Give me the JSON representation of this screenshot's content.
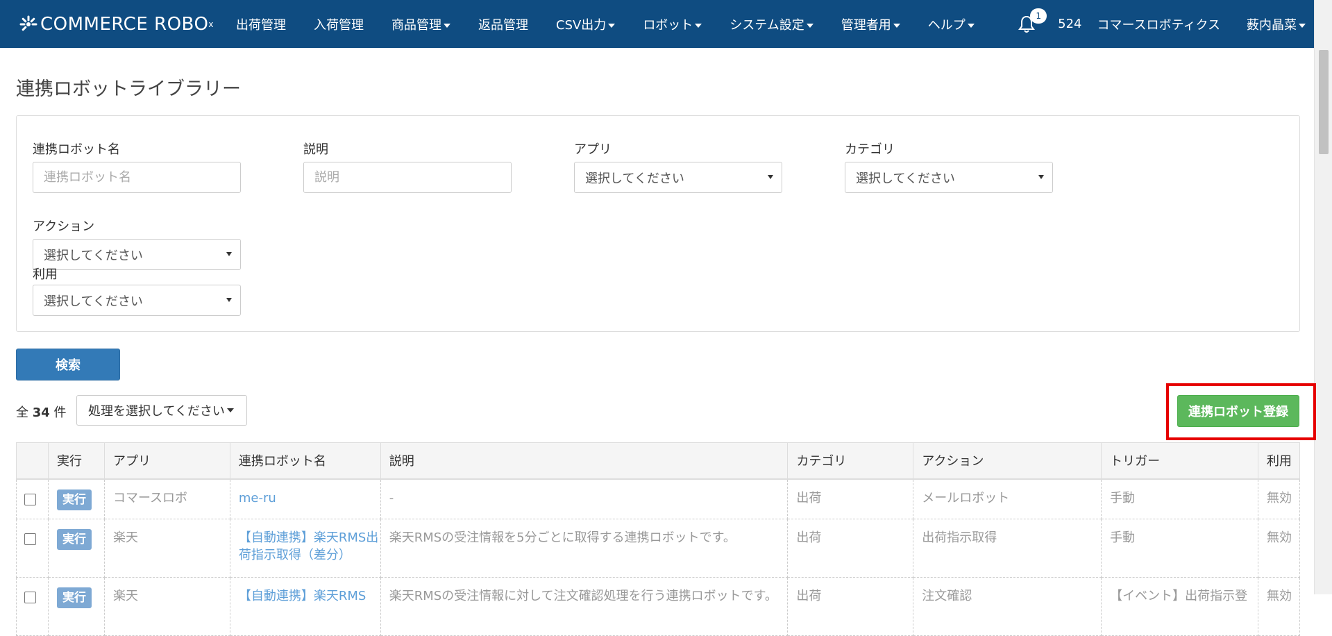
{
  "navbar": {
    "brand": "COMMERCE ROBO",
    "brand_sup": "x",
    "items": [
      {
        "label": "出荷管理",
        "dropdown": false
      },
      {
        "label": "入荷管理",
        "dropdown": false
      },
      {
        "label": "商品管理",
        "dropdown": true
      },
      {
        "label": "返品管理",
        "dropdown": false
      },
      {
        "label": "CSV出力",
        "dropdown": true
      },
      {
        "label": "ロボット",
        "dropdown": true
      },
      {
        "label": "システム設定",
        "dropdown": true
      },
      {
        "label": "管理者用",
        "dropdown": true
      },
      {
        "label": "ヘルプ",
        "dropdown": true
      }
    ],
    "notification_count": "1",
    "shop_id": "524",
    "company": "コマースロボティクス",
    "user": "薮内晶菜"
  },
  "page": {
    "title": "連携ロボットライブラリー"
  },
  "filters": {
    "robot_name_label": "連携ロボット名",
    "robot_name_placeholder": "連携ロボット名",
    "description_label": "説明",
    "description_placeholder": "説明",
    "app_label": "アプリ",
    "app_value": "選択してください",
    "category_label": "カテゴリ",
    "category_value": "選択してください",
    "action_label": "アクション",
    "action_value": "選択してください",
    "usage_label": "利用",
    "usage_value": "選択してください",
    "search_label": "検索"
  },
  "toolbar": {
    "total_prefix": "全",
    "total_count": "34",
    "total_suffix": "件",
    "bulk_action": "処理を選択してください",
    "register_label": "連携ロボット登録"
  },
  "table": {
    "headers": [
      "実行",
      "アプリ",
      "連携ロボット名",
      "説明",
      "カテゴリ",
      "アクション",
      "トリガー",
      "利用"
    ],
    "run_label": "実行",
    "rows": [
      {
        "app": "コマースロボ",
        "name": "me-ru",
        "description": "-",
        "category": "出荷",
        "action": "メールロボット",
        "trigger": "手動",
        "usage": "無効"
      },
      {
        "app": "楽天",
        "name": "【自動連携】楽天RMS出荷指示取得（差分）",
        "description": "楽天RMSの受注情報を5分ごとに取得する連携ロボットです。",
        "category": "出荷",
        "action": "出荷指示取得",
        "trigger": "手動",
        "usage": "無効"
      },
      {
        "app": "楽天",
        "name": "【自動連携】楽天RMS",
        "description": "楽天RMSの受注情報に対して注文確認処理を行う連携ロボットです。",
        "category": "出荷",
        "action": "注文確認",
        "trigger": "【イベント】出荷指示登",
        "usage": "無効"
      }
    ]
  }
}
